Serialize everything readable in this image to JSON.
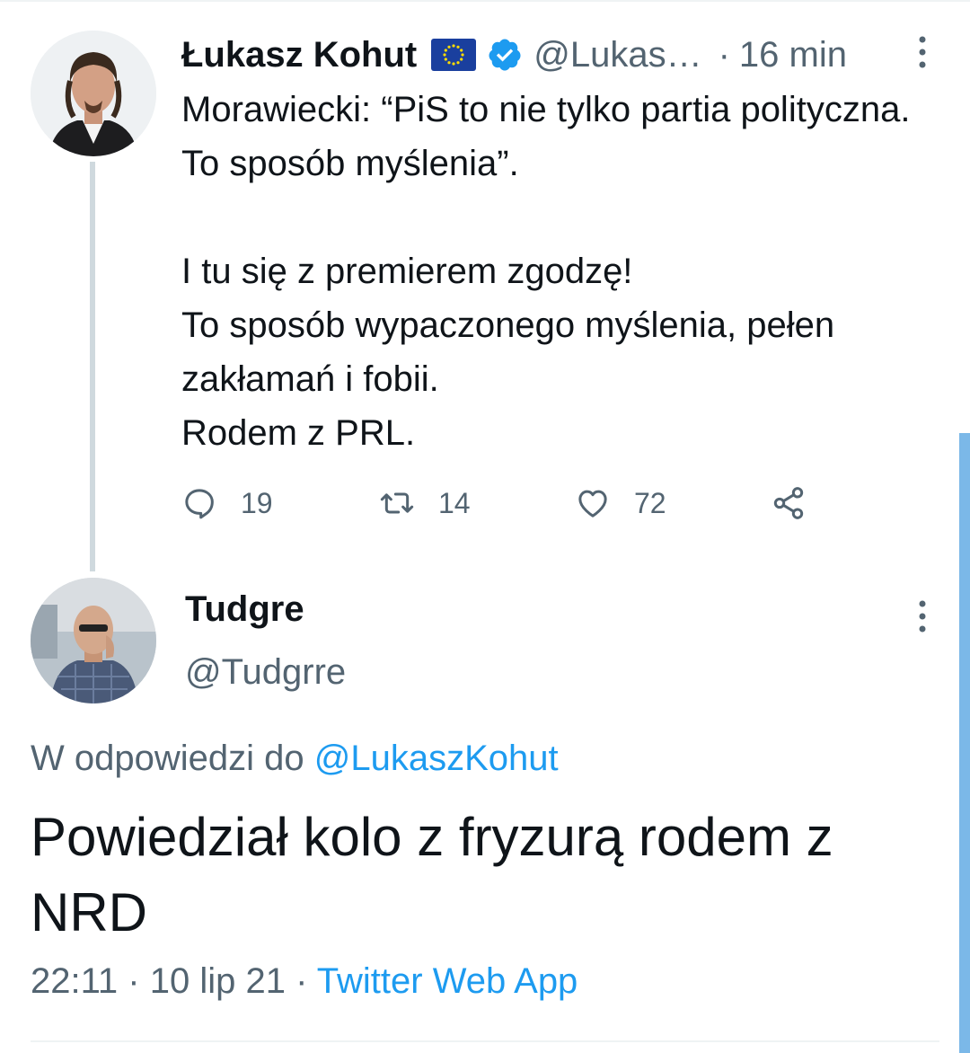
{
  "tweet": {
    "author_name": "Łukasz Kohut",
    "handle": "@Lukas…",
    "separator": "·",
    "time": "16 min",
    "paragraphs": [
      "Morawiecki: “PiS to nie tylko partia polityczna. To sposób myślenia”.",
      "",
      "I tu się z premierem zgodzę!",
      "To sposób wypaczonego myślenia, pełen zakłamań i fobii.",
      "Rodem z PRL."
    ],
    "reply_count": "19",
    "retweet_count": "14",
    "like_count": "72"
  },
  "reply": {
    "author_name": "Tudgre",
    "handle": "@Tudgrre",
    "replying_prefix": "W odpowiedzi do",
    "replying_to": "@LukaszKohut",
    "text": "Powiedział kolo z fryzurą rodem z NRD",
    "time": "22:11",
    "separator": "·",
    "date": "10 lip 21",
    "separator2": "·",
    "source": "Twitter Web App"
  },
  "colors": {
    "accent": "#1d9bf0",
    "secondary_text": "#536471",
    "primary_text": "#0f1419",
    "thread_line": "#cfd9de"
  },
  "icons": [
    "eu-flag-icon",
    "verified-badge-icon",
    "more-options-icon",
    "reply-icon",
    "retweet-icon",
    "like-icon",
    "share-icon"
  ]
}
